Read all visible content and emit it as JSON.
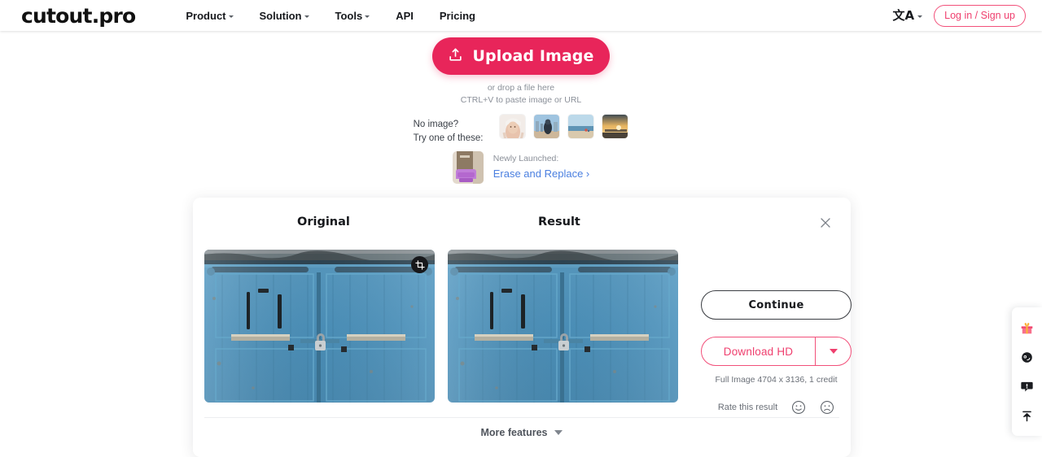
{
  "header": {
    "logo": "cutout.pro",
    "nav": [
      {
        "label": "Product",
        "has_caret": true
      },
      {
        "label": "Solution",
        "has_caret": true
      },
      {
        "label": "Tools",
        "has_caret": true
      },
      {
        "label": "API",
        "has_caret": false
      },
      {
        "label": "Pricing",
        "has_caret": false
      }
    ],
    "language_glyph": "文A",
    "login_label": "Log in / Sign up"
  },
  "upload": {
    "button_label": "Upload Image",
    "hint_line1": "or drop a file here",
    "hint_line2": "CTRL+V to paste image or URL"
  },
  "samples": {
    "label_line1": "No image?",
    "label_line2": "Try one of these:",
    "thumbs": [
      {
        "name": "sample-portrait-towel"
      },
      {
        "name": "sample-city-beach"
      },
      {
        "name": "sample-beach-horizon"
      },
      {
        "name": "sample-sunset-pier"
      }
    ]
  },
  "promo": {
    "kicker": "Newly Launched:",
    "link": "Erase and Replace ›"
  },
  "result_card": {
    "original_title": "Original",
    "result_title": "Result",
    "continue_label": "Continue",
    "download_label": "Download HD",
    "credit_line": "Full Image 4704 x 3136, 1 credit",
    "rate_label": "Rate this result",
    "more_features_label": "More features"
  },
  "float_toolbar": [
    {
      "name": "gift-icon"
    },
    {
      "name": "support-face-icon"
    },
    {
      "name": "feedback-icon"
    },
    {
      "name": "scroll-top-icon"
    }
  ],
  "colors": {
    "accent": "#e8255a",
    "accent_outline": "#ef3f6e",
    "link_blue": "#4a7fe0",
    "text_dark": "#16181c",
    "text_muted": "#8b9099"
  }
}
